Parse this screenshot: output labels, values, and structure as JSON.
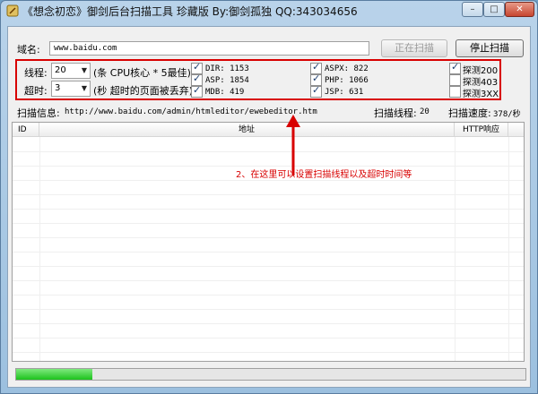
{
  "window": {
    "title": "《想念初恋》御剑后台扫描工具 珍藏版 By:御剑孤独 QQ:343034656",
    "controls": {
      "minimize": "–",
      "maximize": "□",
      "close": "✕"
    }
  },
  "domain": {
    "label": "域名:",
    "value": "www.baidu.com"
  },
  "buttons": {
    "scanning": "正在扫描",
    "stop": "停止扫描"
  },
  "settings": {
    "threads_label": "线程:",
    "threads_value": "20",
    "threads_hint": "(条 CPU核心 * 5最佳)",
    "timeout_label": "超时:",
    "timeout_value": "3",
    "timeout_hint": "(秒 超时的页面被丢弃)"
  },
  "dicts": [
    {
      "label": "DIR: 1153",
      "checked": true
    },
    {
      "label": "ASP: 1854",
      "checked": true
    },
    {
      "label": "MDB: 419",
      "checked": true
    },
    {
      "label": "ASPX: 822",
      "checked": true
    },
    {
      "label": "PHP: 1066",
      "checked": true
    },
    {
      "label": "JSP: 631",
      "checked": true
    }
  ],
  "probes": [
    {
      "label": "探测200",
      "checked": true
    },
    {
      "label": "探测403",
      "checked": false
    },
    {
      "label": "探测3XX",
      "checked": false
    }
  ],
  "status": {
    "info_label": "扫描信息:",
    "info_url": "http://www.baidu.com/admin/htmleditor/ewebeditor.htm",
    "threads_label": "扫描线程:",
    "threads_value": "20",
    "speed_label": "扫描速度:",
    "speed_value": "378/秒"
  },
  "table": {
    "columns": [
      "ID",
      "地址",
      "HTTP响应"
    ]
  },
  "annotation": "2、在这里可以设置扫描线程以及超时时间等",
  "progress": {
    "fraction": 0.15
  }
}
